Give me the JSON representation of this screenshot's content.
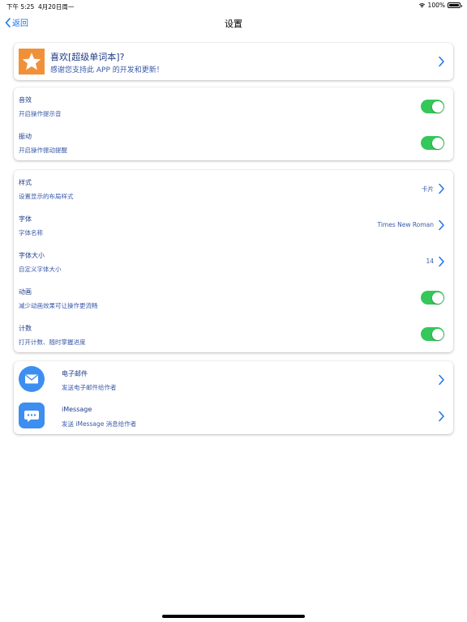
{
  "status_bar": {
    "time": "下午 5:25",
    "date": "4月20日周一",
    "battery": "100%"
  },
  "nav": {
    "back_label": "返回",
    "title": "设置"
  },
  "promo": {
    "title": "喜欢[超级单词本]?",
    "subtitle": "感谢您支持此 APP 的开发和更新！",
    "icon": "star-icon",
    "icon_color": "#f0913a"
  },
  "feedback": [
    {
      "title": "音效",
      "subtitle": "开启操作提示音",
      "toggle": true
    },
    {
      "title": "振动",
      "subtitle": "开启操作振动提醒",
      "toggle": true
    }
  ],
  "display": [
    {
      "title": "样式",
      "subtitle": "设置显示的布局样式",
      "value": "卡片"
    },
    {
      "title": "字体",
      "subtitle": "字体名称",
      "value": "Times New Roman"
    },
    {
      "title": "字体大小",
      "subtitle": "自定义字体大小",
      "value": "14"
    },
    {
      "title": "动画",
      "subtitle": "减少动画效果可让操作更流畅",
      "toggle": true
    },
    {
      "title": "计数",
      "subtitle": "打开计数、随时掌握进度",
      "toggle": true
    }
  ],
  "contact": [
    {
      "title": "电子邮件",
      "subtitle": "发送电子邮件给作者",
      "icon": "mail-icon"
    },
    {
      "title": "iMessage",
      "subtitle": "发送 iMessage 消息给作者",
      "icon": "message-icon"
    }
  ],
  "colors": {
    "accent": "#1a73e8",
    "toggle_on": "#34c759",
    "text_primary": "#1f3c88",
    "icon_blue": "#3d8ef0"
  }
}
